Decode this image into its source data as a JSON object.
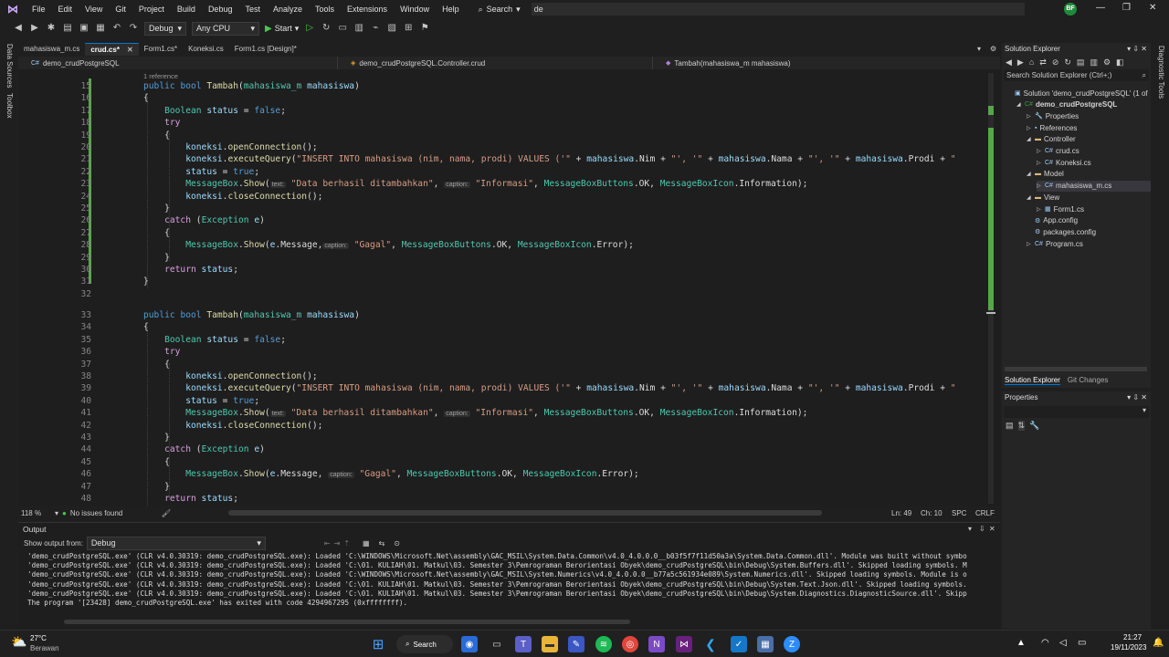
{
  "menubar": {
    "items": [
      "File",
      "Edit",
      "View",
      "Git",
      "Project",
      "Build",
      "Debug",
      "Test",
      "Analyze",
      "Tools",
      "Extensions",
      "Window",
      "Help"
    ],
    "search_label": "Search",
    "solution_name": "de",
    "avatar": "BF"
  },
  "toolbar": {
    "config": "Debug",
    "platform": "Any CPU",
    "start_label": "Start"
  },
  "leftstrip": [
    "Data Sources",
    "Toolbox"
  ],
  "rightstrip": [
    "Diagnostic Tools"
  ],
  "doc_tabs": [
    {
      "label": "mahasiswa_m.cs",
      "active": false
    },
    {
      "label": "crud.cs*",
      "active": true
    },
    {
      "label": "Form1.cs*",
      "active": false
    },
    {
      "label": "Koneksi.cs",
      "active": false
    },
    {
      "label": "Form1.cs [Design]*",
      "active": false
    }
  ],
  "navbar": {
    "project": "demo_crudPostgreSQL",
    "class": "demo_crudPostgreSQL.Controller.crud",
    "member": "Tambah(mahasiswa_m mahasiswa)"
  },
  "editor": {
    "reference_label": "1 reference",
    "line_numbers": [
      "15",
      "16",
      "17",
      "18",
      "19",
      "20",
      "21",
      "22",
      "23",
      "24",
      "25",
      "26",
      "27",
      "28",
      "29",
      "30",
      "31",
      "32",
      "33",
      "34",
      "35",
      "36",
      "37",
      "38",
      "39",
      "40",
      "41",
      "42",
      "43",
      "44",
      "45",
      "46",
      "47",
      "48"
    ]
  },
  "editor_status": {
    "zoom": "118 %",
    "issues": "No issues found",
    "ln": "Ln: 49",
    "ch": "Ch: 10",
    "spc": "SPC",
    "crlf": "CRLF"
  },
  "output": {
    "title": "Output",
    "show_from_label": "Show output from:",
    "show_from_value": "Debug",
    "lines": [
      "'demo_crudPostgreSQL.exe' (CLR v4.0.30319: demo_crudPostgreSQL.exe): Loaded 'C:\\WINDOWS\\Microsoft.Net\\assembly\\GAC_MSIL\\System.Data.Common\\v4.0_4.0.0.0__b03f5f7f11d50a3a\\System.Data.Common.dll'. Module was built without symbo",
      "'demo_crudPostgreSQL.exe' (CLR v4.0.30319: demo_crudPostgreSQL.exe): Loaded 'C:\\01. KULIAH\\01. Matkul\\03. Semester 3\\Pemrograman Berorientasi Obyek\\demo_crudPostgreSQL\\bin\\Debug\\System.Buffers.dll'. Skipped loading symbols. M",
      "'demo_crudPostgreSQL.exe' (CLR v4.0.30319: demo_crudPostgreSQL.exe): Loaded 'C:\\WINDOWS\\Microsoft.Net\\assembly\\GAC_MSIL\\System.Numerics\\v4.0_4.0.0.0__b77a5c561934e089\\System.Numerics.dll'. Skipped loading symbols. Module is o",
      "'demo_crudPostgreSQL.exe' (CLR v4.0.30319: demo_crudPostgreSQL.exe): Loaded 'C:\\01. KULIAH\\01. Matkul\\03. Semester 3\\Pemrograman Berorientasi Obyek\\demo_crudPostgreSQL\\bin\\Debug\\System.Text.Json.dll'. Skipped loading symbols.",
      "'demo_crudPostgreSQL.exe' (CLR v4.0.30319: demo_crudPostgreSQL.exe): Loaded 'C:\\01. KULIAH\\01. Matkul\\03. Semester 3\\Pemrograman Berorientasi Obyek\\demo_crudPostgreSQL\\bin\\Debug\\System.Diagnostics.DiagnosticSource.dll'. Skipp",
      "The program '[23428] demo_crudPostgreSQL.exe' has exited with code 4294967295 (0xffffffff)."
    ]
  },
  "solution_explorer": {
    "title": "Solution Explorer",
    "search_placeholder": "Search Solution Explorer (Ctrl+;)",
    "items": [
      {
        "label": "Solution 'demo_crudPostgreSQL' (1 of",
        "indent": 0,
        "icon": "solution-icon",
        "arrow": ""
      },
      {
        "label": "demo_crudPostgreSQL",
        "indent": 1,
        "icon": "csproj-icon",
        "arrow": "open",
        "bold": true
      },
      {
        "label": "Properties",
        "indent": 2,
        "icon": "wrench-icon",
        "arrow": "closed"
      },
      {
        "label": "References",
        "indent": 2,
        "icon": "references-icon",
        "arrow": "closed"
      },
      {
        "label": "Controller",
        "indent": 2,
        "icon": "folder-icon",
        "arrow": "open"
      },
      {
        "label": "crud.cs",
        "indent": 3,
        "icon": "csharp-file-icon",
        "arrow": "closed"
      },
      {
        "label": "Koneksi.cs",
        "indent": 3,
        "icon": "csharp-file-icon",
        "arrow": "closed"
      },
      {
        "label": "Model",
        "indent": 2,
        "icon": "folder-icon",
        "arrow": "open"
      },
      {
        "label": "mahasiswa_m.cs",
        "indent": 3,
        "icon": "csharp-file-icon",
        "arrow": "closed",
        "selected": true
      },
      {
        "label": "View",
        "indent": 2,
        "icon": "folder-icon",
        "arrow": "open"
      },
      {
        "label": "Form1.cs",
        "indent": 3,
        "icon": "form-icon",
        "arrow": "closed"
      },
      {
        "label": "App.config",
        "indent": 2,
        "icon": "config-icon",
        "arrow": ""
      },
      {
        "label": "packages.config",
        "indent": 2,
        "icon": "config-icon",
        "arrow": ""
      },
      {
        "label": "Program.cs",
        "indent": 2,
        "icon": "csharp-file-icon",
        "arrow": "closed"
      }
    ],
    "tabs": [
      "Solution Explorer",
      "Git Changes"
    ]
  },
  "properties": {
    "title": "Properties"
  },
  "taskbar": {
    "weather_temp": "27°C",
    "weather_desc": "Berawan",
    "search_label": "Search",
    "time": "21:27",
    "date": "19/11/2023"
  }
}
